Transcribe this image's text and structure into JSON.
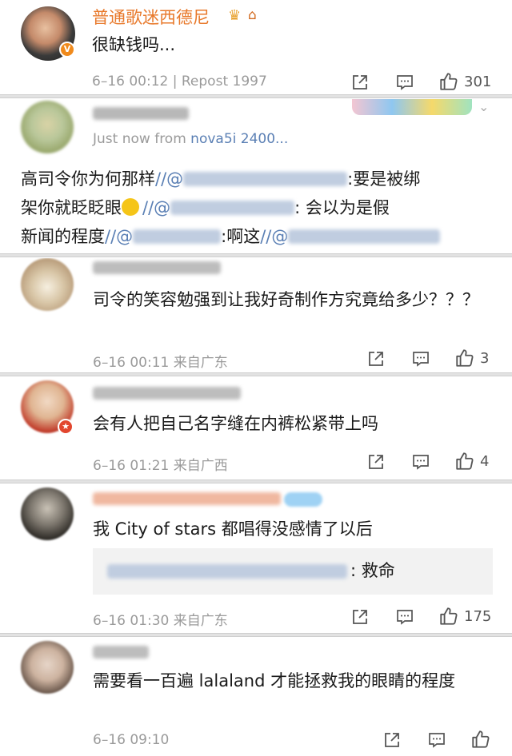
{
  "comments": [
    {
      "name": "普通歌迷西德尼",
      "name_color": "#e8792b",
      "text": "很缺钱吗...",
      "date": "6–16 00:12",
      "repost_label": "| Repost 1997",
      "likes": "301",
      "verified_badge": "V"
    },
    {
      "meta_time": "Just now",
      "meta_from": "from",
      "meta_device": "nova5i 2400...",
      "line1_a": "高司令你为何那样",
      "line1_b": ":要是被绑",
      "line2_a": "架你就眨眨眼",
      "line2_b": ": 会以为是假",
      "line3_a": "新闻的程度",
      "line3_b": ":啊这",
      "slash": "//",
      "at": "@"
    },
    {
      "text": "司令的笑容勉强到让我好奇制作方究竟给多少？？？",
      "date": "6–16 00:11",
      "location": "来自广东",
      "likes": "3"
    },
    {
      "text": "会有人把自己名字缝在内裤松紧带上吗",
      "date": "6–16 01:21",
      "location": "来自广西",
      "likes": "4"
    },
    {
      "text": "我 City of stars 都唱得没感情了以后",
      "reply_text": ": 救命",
      "date": "6–16 01:30",
      "location": "来自广东",
      "likes": "175"
    },
    {
      "text": "需要看一百遍 lalaland 才能拯救我的眼睛的程度",
      "date": "6–16 09:10"
    }
  ],
  "icons": [
    "share-icon",
    "comment-icon",
    "like-icon",
    "chevron-down-icon",
    "crown-icon",
    "hat-icon"
  ],
  "colors": {
    "mention": "#5a7fb4",
    "meta": "#9a9a9a",
    "separator": "#e2e2e2"
  }
}
